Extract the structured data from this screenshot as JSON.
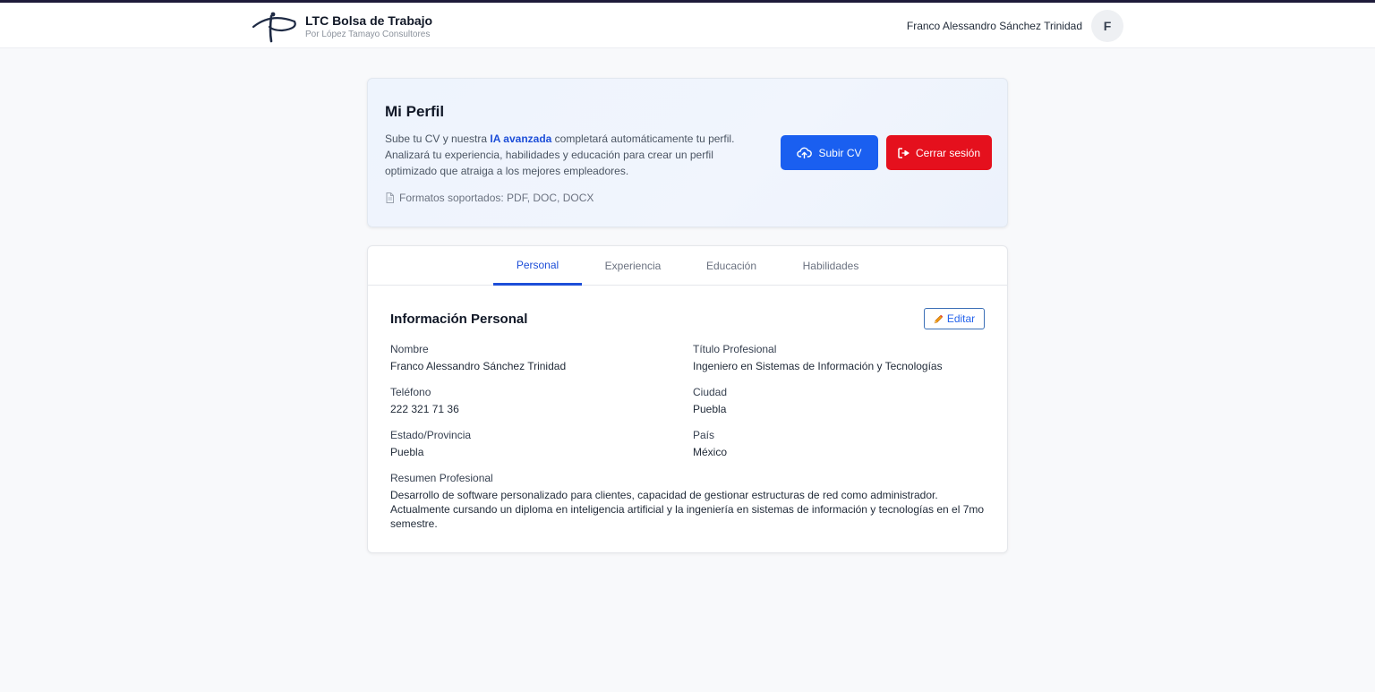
{
  "colors": {
    "primary": "#1a5ff0",
    "danger": "#e5101d",
    "accent_text": "#1d4ed8",
    "page_bg": "#f8f9fb",
    "top_border": "#1e1b3a"
  },
  "header": {
    "brand_title": "LTC Bolsa de Trabajo",
    "brand_subtitle": "Por López Tamayo Consultores",
    "user_name": "Franco Alessandro Sánchez Trinidad",
    "avatar_initial": "F"
  },
  "profile": {
    "title": "Mi Perfil",
    "desc_before": "Sube tu CV y nuestra ",
    "desc_highlight": "IA avanzada",
    "desc_after": " completará automáticamente tu perfil. Analizará tu experiencia, habilidades y educación para crear un perfil optimizado que atraiga a los mejores empleadores.",
    "formats": "Formatos soportados: PDF, DOC, DOCX",
    "upload_label": "Subir CV",
    "logout_label": "Cerrar sesión"
  },
  "tabs": [
    {
      "label": "Personal",
      "active": true
    },
    {
      "label": "Experiencia",
      "active": false
    },
    {
      "label": "Educación",
      "active": false
    },
    {
      "label": "Habilidades",
      "active": false
    }
  ],
  "personal": {
    "section_title": "Información Personal",
    "edit_label": "Editar",
    "fields": {
      "nombre": {
        "label": "Nombre",
        "value": "Franco Alessandro Sánchez Trinidad"
      },
      "titulo": {
        "label": "Título Profesional",
        "value": "Ingeniero en Sistemas de Información y Tecnologías"
      },
      "telefono": {
        "label": "Teléfono",
        "value": "222 321 71 36"
      },
      "ciudad": {
        "label": "Ciudad",
        "value": "Puebla"
      },
      "estado": {
        "label": "Estado/Provincia",
        "value": "Puebla"
      },
      "pais": {
        "label": "País",
        "value": "México"
      }
    },
    "summary_label": "Resumen Profesional",
    "summary": "Desarrollo de software personalizado para clientes, capacidad de gestionar estructuras de red como administrador. Actualmente cursando un diploma en inteligencia artificial y la ingeniería en sistemas de información y tecnologías en el 7mo semestre."
  }
}
